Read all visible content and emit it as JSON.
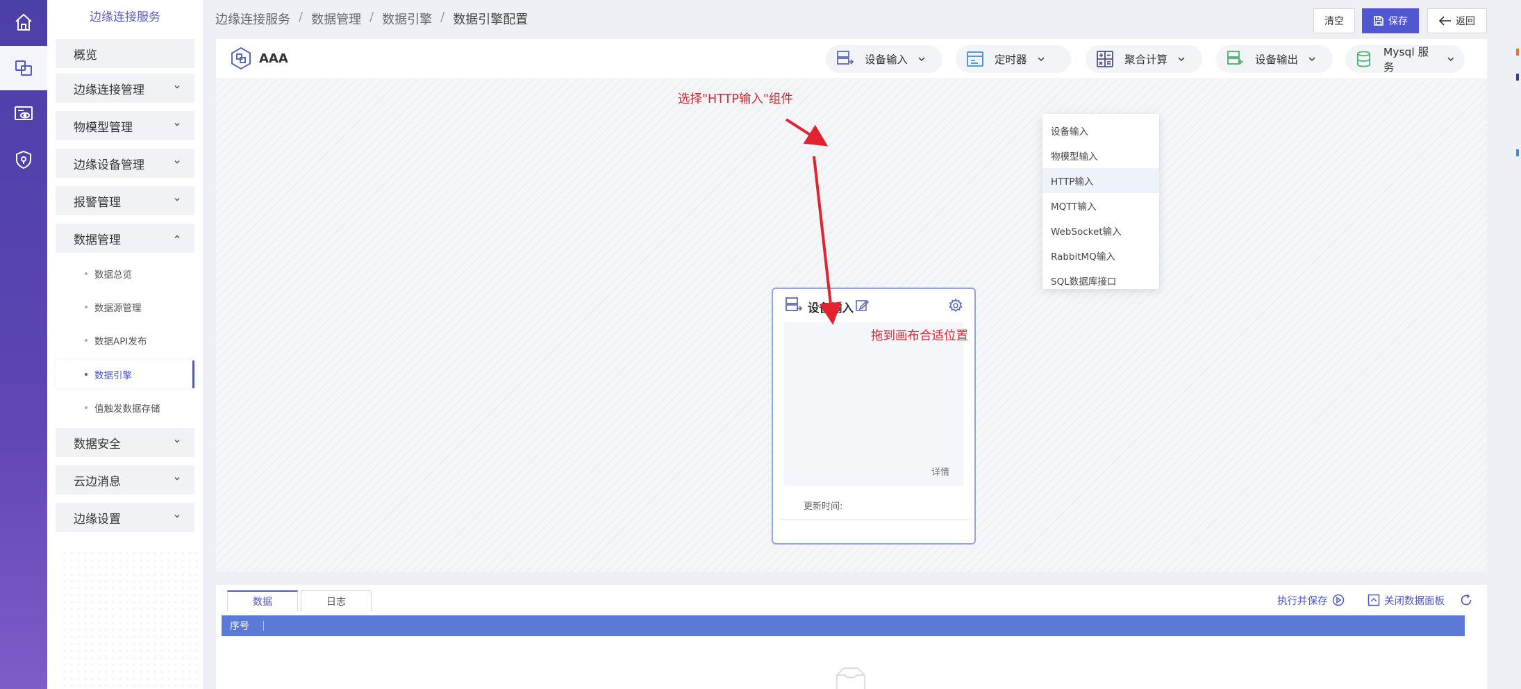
{
  "sidebar": {
    "title": "边缘连接服务",
    "items": [
      {
        "label": "概览"
      },
      {
        "label": "边缘连接管理"
      },
      {
        "label": "物模型管理"
      },
      {
        "label": "边缘设备管理"
      },
      {
        "label": "报警管理"
      },
      {
        "label": "数据管理"
      }
    ],
    "sub_items": [
      {
        "label": "数据总览"
      },
      {
        "label": "数据源管理"
      },
      {
        "label": "数据API发布"
      },
      {
        "label": "数据引擎"
      },
      {
        "label": "值触发数据存储"
      }
    ],
    "items_after": [
      {
        "label": "数据安全"
      },
      {
        "label": "云边消息"
      },
      {
        "label": "边缘设置"
      }
    ]
  },
  "breadcrumb": {
    "items": [
      "边缘连接服务",
      "数据管理",
      "数据引擎",
      "数据引擎配置"
    ],
    "separator": "/"
  },
  "top_buttons": {
    "clear": "清空",
    "save": "保存",
    "back": "返回"
  },
  "panel": {
    "app_name": "AAA",
    "toolbar": [
      {
        "label": "设备输入"
      },
      {
        "label": "定时器"
      },
      {
        "label": "聚合计算"
      },
      {
        "label": "设备输出"
      },
      {
        "label": "Mysql 服务"
      }
    ]
  },
  "dropdown": {
    "items": [
      "设备输入",
      "物模型输入",
      "HTTP输入",
      "MQTT输入",
      "WebSocket输入",
      "RabbitMQ输入",
      "SQL数据库接口"
    ],
    "highlighted": "HTTP输入"
  },
  "node": {
    "title": "设备输入",
    "detail_link": "详情",
    "update_time_label": "更新时间:"
  },
  "annotations": {
    "select_hint": "选择\"HTTP输入\"组件",
    "drag_hint": "拖到画布合适位置"
  },
  "bottom": {
    "tabs": [
      "数据",
      "日志"
    ],
    "run_save": "执行并保存",
    "close_panel": "关闭数据面板",
    "table_header": "序号"
  },
  "colors": {
    "accent": "#5057d0",
    "rail_gradient_top": "#4b3fa8",
    "annotation_red": "#e4222f",
    "table_header_bg": "#5b79d6"
  }
}
